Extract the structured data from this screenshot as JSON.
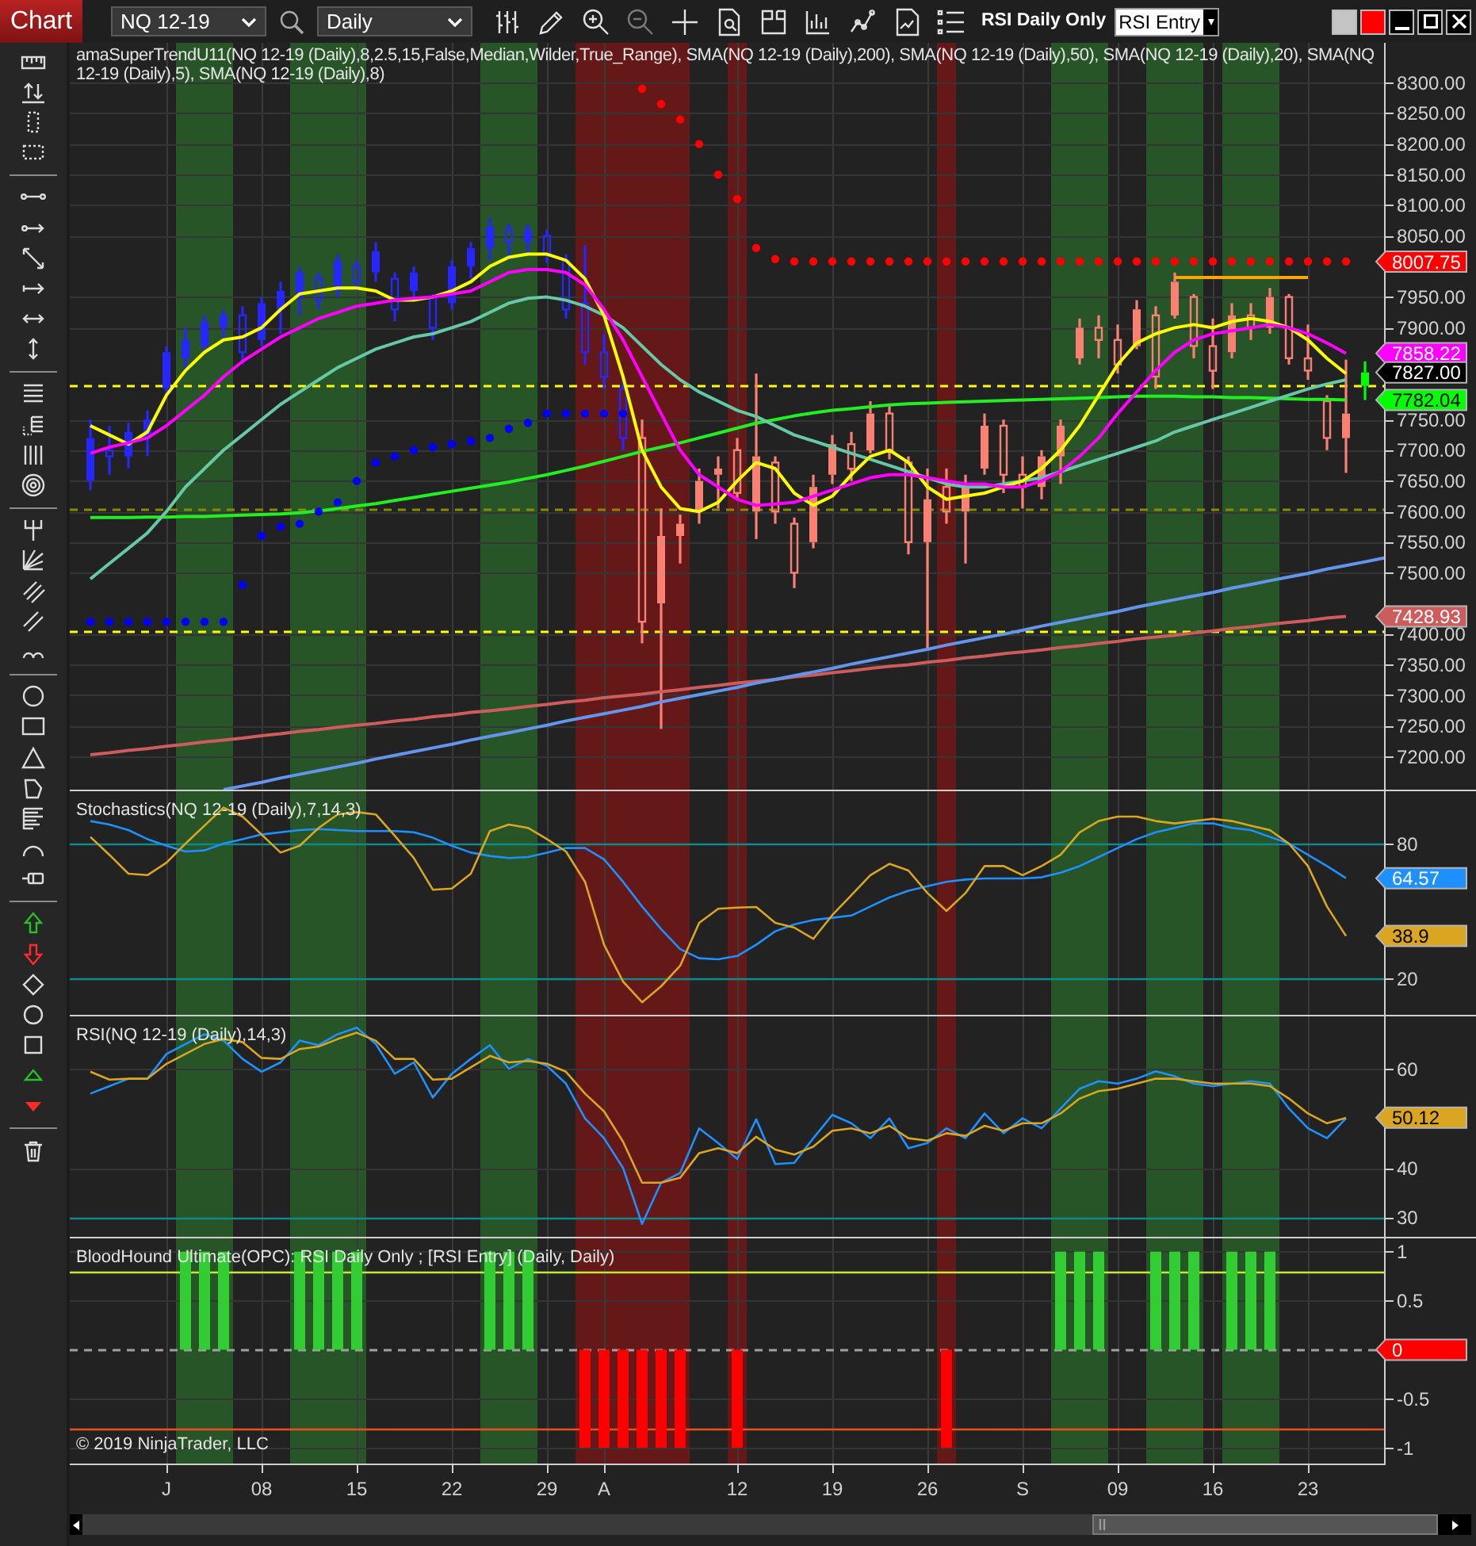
{
  "toolbar": {
    "tab": "Chart",
    "instrument": "NQ 12-19",
    "interval": "Daily",
    "zoom_out": {
      "disabled": true
    },
    "strategy_name": "RSI Daily Only",
    "strategy_entry": "RSI Entry"
  },
  "panels": [
    {
      "kind": "price",
      "chart_data": {
        "type": "candlestick",
        "title": "amaSuperTrendU11(NQ 12-19 (Daily),8,2.5,15,False,Median,Wilder,True_Range), SMA(NQ 12-19 (Daily),200), SMA(NQ 12-19 (Daily),50), SMA(NQ 12-19 (Daily),20), SMA(NQ 12-19 (Daily),5), SMA(NQ 12-19 (Daily),8)",
        "ylim": [
          7146,
          8365
        ],
        "grid": true,
        "yticks": [
          {
            "value": 7200,
            "label": "7200.00"
          },
          {
            "value": 7250,
            "label": "7250.00"
          },
          {
            "value": 7300,
            "label": "7300.00"
          },
          {
            "value": 7350,
            "label": "7350.00"
          },
          {
            "value": 7400,
            "label": "7400.00"
          },
          {
            "value": 7500,
            "label": "7500.00"
          },
          {
            "value": 7550,
            "label": "7550.00"
          },
          {
            "value": 7600,
            "label": "7600.00"
          },
          {
            "value": 7650,
            "label": "7650.00"
          },
          {
            "value": 7700,
            "label": "7700.00"
          },
          {
            "value": 7750,
            "label": "7750.00"
          },
          {
            "value": 7900,
            "label": "7900.00"
          },
          {
            "value": 7950,
            "label": "7950.00"
          },
          {
            "value": 8050,
            "label": "8050.00"
          },
          {
            "value": 8100,
            "label": "8100.00"
          },
          {
            "value": 8150,
            "label": "8150.00"
          },
          {
            "value": 8200,
            "label": "8200.00"
          },
          {
            "value": 8250,
            "label": "8250.00"
          },
          {
            "value": 8300,
            "label": "8300.00"
          }
        ],
        "series": [
          {
            "type": "line",
            "color": "#cd5c5c",
            "values": [
              7203,
              7206,
              7210,
              7213,
              7217,
              7220,
              7224,
              7227,
              7230,
              7234,
              7237,
              7241,
              7244,
              7248,
              7251,
              7254,
              7258,
              7261,
              7265,
              7268,
              7272,
              7275,
              7278,
              7282,
              7285,
              7289,
              7292,
              7296,
              7299,
              7302,
              7306,
              7309,
              7313,
              7316,
              7320,
              7323,
              7326,
              7330,
              7333,
              7337,
              7340,
              7344,
              7347,
              7350,
              7354,
              7357,
              7361,
              7364,
              7368,
              7371,
              7374,
              7378,
              7381,
              7385,
              7388,
              7392,
              7395,
              7398,
              7402,
              7405,
              7409,
              7412,
              7416,
              7419,
              7422,
              7426,
              7429
            ]
          },
          {
            "type": "line",
            "color": "#22ee22",
            "values": [
              7590,
              7590,
              7590,
              7591,
              7591,
              7592,
              7592,
              7593,
              7594,
              7595,
              7596,
              7598,
              7601,
              7605,
              7609,
              7613,
              7618,
              7623,
              7628,
              7633,
              7638,
              7643,
              7648,
              7654,
              7660,
              7667,
              7674,
              7682,
              7690,
              7698,
              7705,
              7712,
              7720,
              7728,
              7736,
              7744,
              7750,
              7756,
              7761,
              7765,
              7768,
              7771,
              7774,
              7776,
              7777,
              7778,
              7779,
              7780,
              7781,
              7782,
              7783,
              7784,
              7785,
              7786,
              7787,
              7788,
              7788,
              7788,
              7787,
              7787,
              7786,
              7786,
              7785,
              7784,
              7783,
              7783,
              7782
            ]
          },
          {
            "type": "line",
            "color": "#66c8a6",
            "values": [
              7490,
              7515,
              7540,
              7565,
              7600,
              7640,
              7670,
              7700,
              7725,
              7750,
              7775,
              7795,
              7815,
              7835,
              7850,
              7865,
              7875,
              7885,
              7890,
              7900,
              7910,
              7925,
              7940,
              7948,
              7950,
              7945,
              7935,
              7920,
              7900,
              7870,
              7840,
              7815,
              7795,
              7780,
              7765,
              7755,
              7740,
              7725,
              7715,
              7705,
              7695,
              7685,
              7675,
              7665,
              7655,
              7645,
              7640,
              7640,
              7645,
              7650,
              7655,
              7665,
              7675,
              7685,
              7695,
              7705,
              7715,
              7730,
              7740,
              7750,
              7760,
              7770,
              7780,
              7790,
              7800,
              7808,
              7815
            ]
          },
          {
            "type": "line",
            "color": "#ffff00",
            "values": [
              7740,
              7725,
              7710,
              7730,
              7790,
              7830,
              7860,
              7880,
              7885,
              7900,
              7930,
              7955,
              7960,
              7965,
              7965,
              7960,
              7945,
              7945,
              7950,
              7960,
              7975,
              8000,
              8015,
              8020,
              8020,
              8010,
              7980,
              7920,
              7820,
              7700,
              7640,
              7605,
              7600,
              7615,
              7650,
              7680,
              7670,
              7630,
              7610,
              7625,
              7660,
              7690,
              7700,
              7680,
              7640,
              7620,
              7625,
              7630,
              7640,
              7650,
              7670,
              7700,
              7740,
              7790,
              7840,
              7875,
              7890,
              7900,
              7905,
              7900,
              7910,
              7915,
              7910,
              7900,
              7880,
              7850,
              7825
            ]
          },
          {
            "type": "line",
            "color": "#ff00ff",
            "values": [
              7695,
              7705,
              7712,
              7720,
              7740,
              7765,
              7790,
              7820,
              7845,
              7865,
              7885,
              7900,
              7915,
              7925,
              7935,
              7940,
              7945,
              7948,
              7950,
              7955,
              7960,
              7975,
              7990,
              7995,
              7995,
              7990,
              7970,
              7930,
              7880,
              7820,
              7760,
              7700,
              7660,
              7640,
              7620,
              7610,
              7612,
              7615,
              7625,
              7635,
              7645,
              7655,
              7660,
              7660,
              7655,
              7650,
              7645,
              7645,
              7640,
              7640,
              7650,
              7665,
              7690,
              7720,
              7760,
              7795,
              7830,
              7860,
              7880,
              7890,
              7895,
              7900,
              7905,
              7900,
              7890,
              7875,
              7858
            ]
          },
          {
            "type": "scatter",
            "color": "#ff0000",
            "values": [
              null,
              null,
              null,
              null,
              null,
              null,
              null,
              null,
              null,
              null,
              null,
              null,
              null,
              null,
              null,
              null,
              null,
              null,
              null,
              null,
              null,
              null,
              null,
              null,
              null,
              null,
              null,
              null,
              null,
              8290,
              8265,
              8240,
              8200,
              8150,
              8110,
              8030,
              8012,
              8008,
              8008,
              8008,
              8008,
              8008,
              8008,
              8008,
              8008,
              8008,
              8008,
              8008,
              8008,
              8008,
              8008,
              8008,
              8008,
              8008,
              8008,
              8008,
              8008,
              8008,
              8008,
              8008,
              8008,
              8008,
              8008,
              8008,
              8008,
              8008,
              8008
            ]
          },
          {
            "type": "scatter",
            "color": "#0000ff",
            "values": [
              7420,
              7420,
              7420,
              7420,
              7420,
              7420,
              7420,
              7420,
              7480,
              7560,
              7575,
              7580,
              7600,
              7615,
              7650,
              7680,
              7690,
              7700,
              7705,
              7710,
              7715,
              7720,
              7735,
              7745,
              7760,
              7760,
              7760,
              7760,
              7760
            ]
          },
          {
            "type": "candlestick",
            "color": "#2626ff",
            "ohlc": [
              [
                7650,
                7750,
                7635,
                7720
              ],
              [
                7700,
                7740,
                7660,
                7690
              ],
              [
                7690,
                7745,
                7670,
                7730
              ],
              [
                7720,
                7765,
                7690,
                7750
              ],
              [
                7800,
                7870,
                7790,
                7860
              ],
              [
                7850,
                7900,
                7830,
                7880
              ],
              [
                7870,
                7920,
                7860,
                7910
              ],
              [
                7900,
                7930,
                7880,
                7920
              ],
              [
                7920,
                7935,
                7840,
                7860
              ],
              [
                7880,
                7950,
                7870,
                7940
              ],
              [
                7930,
                7975,
                7890,
                7960
              ],
              [
                7950,
                8000,
                7920,
                7990
              ],
              [
                7980,
                7990,
                7930,
                7945
              ],
              [
                7960,
                8020,
                7950,
                8010
              ],
              [
                8000,
                8010,
                7960,
                7975
              ],
              [
                7990,
                8040,
                7975,
                8025
              ],
              [
                7980,
                7990,
                7910,
                7930
              ],
              [
                7960,
                8000,
                7950,
                7990
              ],
              [
                7950,
                7955,
                7880,
                7900
              ],
              [
                7940,
                8010,
                7930,
                8000
              ],
              [
                8000,
                8040,
                7980,
                8030
              ],
              [
                8030,
                8080,
                8010,
                8065
              ],
              [
                8060,
                8070,
                8010,
                8040
              ],
              [
                8040,
                8070,
                8020,
                8060
              ],
              [
                8050,
                8060,
                8005,
                8020
              ],
              [
                8010,
                8020,
                7915,
                7930
              ],
              [
                7940,
                8035,
                7840,
                7860
              ],
              [
                7860,
                7890,
                7800,
                7820
              ],
              [
                7800,
                7815,
                7700,
                7720
              ]
            ]
          },
          {
            "type": "candlestick",
            "color": "#fa8072",
            "ohlc": [
              null,
              null,
              null,
              null,
              null,
              null,
              null,
              null,
              null,
              null,
              null,
              null,
              null,
              null,
              null,
              null,
              null,
              null,
              null,
              null,
              null,
              null,
              null,
              null,
              null,
              null,
              null,
              null,
              null,
              [
                7720,
                7750,
                7385,
                7420
              ],
              [
                7450,
                7605,
                7245,
                7560
              ],
              [
                7560,
                7595,
                7515,
                7580
              ],
              [
                7600,
                7670,
                7580,
                7650
              ],
              [
                7660,
                7690,
                7605,
                7670
              ],
              [
                7700,
                7720,
                7620,
                7630
              ],
              [
                7600,
                7825,
                7555,
                7690
              ],
              [
                7680,
                7690,
                7580,
                7600
              ],
              [
                7580,
                7590,
                7475,
                7500
              ],
              [
                7550,
                7660,
                7540,
                7640
              ],
              [
                7660,
                7725,
                7645,
                7710
              ],
              [
                7710,
                7730,
                7650,
                7670
              ],
              [
                7700,
                7780,
                7695,
                7760
              ],
              [
                7760,
                7775,
                7685,
                7700
              ],
              [
                7680,
                7690,
                7530,
                7550
              ],
              [
                7550,
                7670,
                7375,
                7620
              ],
              [
                7640,
                7670,
                7580,
                7600
              ],
              [
                7600,
                7660,
                7515,
                7640
              ],
              [
                7670,
                7760,
                7660,
                7740
              ],
              [
                7740,
                7750,
                7630,
                7660
              ],
              [
                7660,
                7690,
                7605,
                7640
              ],
              [
                7640,
                7700,
                7620,
                7690
              ],
              [
                7690,
                7750,
                7645,
                7740
              ],
              [
                7850,
                7915,
                7840,
                7900
              ],
              [
                7900,
                7920,
                7850,
                7880
              ],
              [
                7880,
                7905,
                7825,
                7840
              ],
              [
                7870,
                7945,
                7865,
                7930
              ],
              [
                7920,
                7935,
                7800,
                7820
              ],
              [
                7920,
                7990,
                7915,
                7975
              ],
              [
                7950,
                7955,
                7850,
                7870
              ],
              [
                7870,
                7915,
                7800,
                7830
              ],
              [
                7860,
                7940,
                7850,
                7920
              ],
              [
                7920,
                7940,
                7880,
                7900
              ],
              [
                7900,
                7965,
                7890,
                7950
              ],
              [
                7950,
                7955,
                7840,
                7850
              ],
              [
                7850,
                7905,
                7815,
                7830
              ],
              [
                7780,
                7790,
                7700,
                7720
              ],
              [
                7720,
                7848,
                7663,
                7760
              ]
            ]
          },
          {
            "type": "candlestick",
            "color": "#00ff00",
            "ohlc": [
              null,
              null,
              null,
              null,
              null,
              null,
              null,
              null,
              null,
              null,
              null,
              null,
              null,
              null,
              null,
              null,
              null,
              null,
              null,
              null,
              null,
              null,
              null,
              null,
              null,
              null,
              null,
              null,
              null,
              null,
              null,
              null,
              null,
              null,
              null,
              null,
              null,
              null,
              null,
              null,
              null,
              null,
              null,
              null,
              null,
              null,
              null,
              null,
              null,
              null,
              null,
              null,
              null,
              null,
              null,
              null,
              null,
              null,
              null,
              null,
              null,
              null,
              null,
              null,
              null,
              null,
              null,
              [
                7805,
                7845,
                7782,
                7827
              ]
            ]
          },
          {
            "type": "line",
            "color": "#6495ed",
            "values": [
              null,
              null,
              null,
              null,
              null,
              null,
              null,
              7146,
              7152,
              7158,
              7165,
              7171,
              7177,
              7183,
              7189,
              7196,
              7202,
              7208,
              7214,
              7220,
              7227,
              7233,
              7239,
              7245,
              7251,
              7258,
              7264,
              7270,
              7276,
              7282,
              7289,
              7295,
              7301,
              7307,
              7313,
              7320,
              7326,
              7332,
              7338,
              7344,
              7351,
              7357,
              7363,
              7369,
              7375,
              7382,
              7388,
              7394,
              7400,
              7406,
              7413,
              7419,
              7425,
              7431,
              7437,
              7444,
              7450,
              7456,
              7462,
              7468,
              7475,
              7481,
              7487,
              7493,
              7499,
              7506,
              7512,
              7518,
              7524
            ]
          },
          {
            "type": "line",
            "color": "#ffa500",
            "values": [
              null,
              null,
              null,
              null,
              null,
              null,
              null,
              null,
              null,
              null,
              null,
              null,
              null,
              null,
              null,
              null,
              null,
              null,
              null,
              null,
              null,
              null,
              null,
              null,
              null,
              null,
              null,
              null,
              null,
              null,
              null,
              null,
              null,
              null,
              null,
              null,
              null,
              null,
              null,
              null,
              null,
              null,
              null,
              null,
              null,
              null,
              null,
              null,
              null,
              null,
              null,
              null,
              null,
              null,
              null,
              null,
              null,
              7982,
              7982,
              7982,
              7982,
              7982,
              7982,
              7982,
              7982
            ]
          }
        ],
        "ref_lines": [
          {
            "axis": "y",
            "value": 7807,
            "color": "#ffff00"
          },
          {
            "axis": "y",
            "value": 7604,
            "color": "#8a8a00"
          },
          {
            "axis": "y",
            "value": 7405,
            "color": "#ffff00"
          }
        ],
        "value_labels": [
          {
            "text": "8007.75",
            "color": "#ff0000"
          },
          {
            "text": "7858.22",
            "color": "#ff00ff"
          },
          {
            "text": "7827.00",
            "color": "#000000"
          },
          {
            "text": "7782.04",
            "color": "#00ff00"
          },
          {
            "text": "7428.93",
            "color": "#cd5c5c"
          }
        ]
      }
    },
    {
      "kind": "oscillator",
      "chart_data": {
        "type": "line",
        "title": "Stochastics(NQ 12-19 (Daily),7,14,3)",
        "ylim": [
          3.8,
          104
        ],
        "grid": true,
        "yticks": [
          {
            "value": 20,
            "label": "20"
          },
          {
            "value": 80,
            "label": "80"
          }
        ],
        "series": [
          {
            "color": "#1e90ff",
            "values": [
              90,
              88.5,
              86,
              82,
              79,
              76.5,
              77,
              80,
              82,
              84,
              85,
              86,
              86.4,
              86,
              85.6,
              85.6,
              85.6,
              85,
              82.6,
              79,
              76,
              74.5,
              73.6,
              74,
              76,
              78,
              78,
              73,
              63,
              52,
              42,
              33,
              29,
              28.5,
              30,
              35,
              41,
              44,
              46,
              47,
              48,
              52,
              56,
              59,
              61,
              63,
              64,
              64.5,
              64.5,
              64.5,
              65,
              67,
              70,
              74,
              78,
              82,
              85,
              87,
              89,
              89,
              87,
              86,
              83,
              80,
              75,
              70,
              64.6
            ]
          },
          {
            "color": "#daa520",
            "values": [
              83,
              75,
              66.6,
              66,
              71.5,
              80,
              88,
              96,
              92,
              84,
              76,
              79,
              87,
              93,
              94,
              93,
              83.5,
              73.6,
              59.5,
              60,
              66.6,
              85.6,
              88.5,
              87,
              82,
              76.5,
              63,
              35,
              18.6,
              9.4,
              16.5,
              25.6,
              44.7,
              51,
              51.5,
              51.8,
              44.7,
              42.6,
              37.6,
              48.2,
              57,
              66,
              71,
              68,
              58,
              50,
              58,
              70,
              70,
              66,
              70,
              75,
              85,
              90,
              92,
              92,
              90,
              89,
              90,
              91,
              90,
              88,
              86,
              80,
              70,
              52,
              38.9
            ]
          }
        ],
        "ref_lines": [
          {
            "axis": "y",
            "value": 80,
            "color": "#0e8a8a"
          },
          {
            "axis": "y",
            "value": 20,
            "color": "#0e8a8a"
          }
        ],
        "value_labels": [
          {
            "text": "64.57",
            "color": "#1e90ff"
          },
          {
            "text": "38.9",
            "color": "#daa520"
          }
        ]
      }
    },
    {
      "kind": "oscillator",
      "chart_data": {
        "type": "line",
        "title": "RSI(NQ 12-19 (Daily),14,3)",
        "ylim": [
          26.1,
          70.9
        ],
        "grid": true,
        "yticks": [
          {
            "value": 30,
            "label": "30"
          },
          {
            "value": 40,
            "label": "40"
          },
          {
            "value": 60,
            "label": "60"
          }
        ],
        "series": [
          {
            "color": "#1e90ff",
            "values": [
              55,
              56.5,
              58,
              58,
              63,
              65,
              67,
              65.7,
              62,
              59.4,
              61.3,
              65.7,
              64.8,
              67,
              68.3,
              65,
              59,
              61.3,
              54.2,
              59,
              62,
              64.8,
              60,
              62,
              60.6,
              57,
              50,
              46,
              40,
              28.7,
              37,
              39,
              48,
              45,
              41.8,
              49.8,
              40.8,
              41,
              46,
              50.7,
              49,
              46,
              50,
              44,
              45,
              48,
              46,
              51,
              47,
              50,
              48,
              52,
              56,
              57.5,
              57,
              58,
              59.5,
              58.5,
              57,
              56.5,
              57,
              57.5,
              57,
              52,
              48,
              46,
              50
            ]
          },
          {
            "color": "#daa520",
            "values": [
              59.4,
              57.8,
              58,
              58,
              61,
              63,
              65,
              66,
              65.4,
              62.2,
              62,
              64,
              64.5,
              66,
              67.3,
              65.7,
              62,
              62,
              57.8,
              58,
              60.3,
              62.6,
              61.3,
              61.6,
              61,
              59.4,
              55,
              51.4,
              45.3,
              37,
              37,
              38,
              43,
              44,
              43,
              46.3,
              43.7,
              42.7,
              44.3,
              47.5,
              48,
              47,
              48.5,
              46,
              45.5,
              47,
              46.5,
              48.5,
              47.5,
              49,
              49,
              51,
              54,
              55.5,
              56,
              57,
              58,
              58,
              57.5,
              57,
              57,
              57,
              56.5,
              54,
              51,
              49,
              50.1
            ]
          }
        ],
        "ref_lines": [
          {
            "axis": "y",
            "value": 30,
            "color": "#0e8a8a"
          }
        ],
        "value_labels": [
          {
            "text": "50.12",
            "color": "#daa520"
          }
        ]
      }
    },
    {
      "kind": "signal",
      "copyright": "© 2019 NinjaTrader, LLC",
      "chart_data": {
        "type": "bar",
        "title": "BloodHound Ultimate(OPC): RSI Daily Only ; [RSI Entry] (Daily, Daily)",
        "categories": [
          null,
          null,
          null,
          null,
          "J",
          null,
          null,
          null,
          null,
          "08",
          null,
          null,
          null,
          null,
          "15",
          null,
          null,
          null,
          null,
          "22",
          null,
          null,
          null,
          null,
          "29",
          null,
          null,
          "A",
          null,
          null,
          null,
          null,
          null,
          null,
          "12",
          null,
          null,
          null,
          null,
          "19",
          null,
          null,
          null,
          null,
          "26",
          null,
          null,
          null,
          null,
          "S",
          null,
          null,
          null,
          null,
          "09",
          null,
          null,
          null,
          null,
          "16",
          null,
          null,
          null,
          null,
          "23",
          null,
          null,
          null
        ],
        "ylim": [
          -1.16,
          1.15
        ],
        "grid": true,
        "yticks": [
          -1,
          -0.5,
          0.5,
          1
        ],
        "series": [
          {
            "color": "#32cd32",
            "values": [
              0,
              0,
              0,
              0,
              0,
              1,
              1,
              1,
              0,
              0,
              0,
              1,
              1,
              1,
              1,
              0,
              0,
              0,
              0,
              0,
              0,
              1,
              1,
              1,
              0,
              0,
              0,
              0,
              0,
              0,
              0,
              0,
              0,
              0,
              0,
              0,
              0,
              0,
              0,
              0,
              0,
              0,
              0,
              0,
              0,
              0,
              0,
              0,
              0,
              0,
              0,
              1,
              1,
              1,
              0,
              0,
              1,
              1,
              1,
              0,
              1,
              1,
              1,
              0,
              0,
              0,
              0,
              0
            ]
          },
          {
            "color": "#ff0000",
            "values": [
              0,
              0,
              0,
              0,
              0,
              0,
              0,
              0,
              0,
              0,
              0,
              0,
              0,
              0,
              0,
              0,
              0,
              0,
              0,
              0,
              0,
              0,
              0,
              0,
              0,
              0,
              -1,
              -1,
              -1,
              -1,
              -1,
              -1,
              0,
              0,
              -1,
              0,
              0,
              0,
              0,
              0,
              0,
              0,
              0,
              0,
              0,
              -1,
              0,
              0,
              0,
              0,
              0,
              0,
              0,
              0,
              0,
              0,
              0,
              0,
              0,
              0,
              0,
              0,
              0,
              0,
              0,
              0,
              0,
              0
            ]
          }
        ],
        "ref_lines": [
          {
            "axis": "y",
            "value": 0.8,
            "color": "#c4e83a"
          },
          {
            "axis": "y",
            "value": -0.8,
            "color": "#e8501e"
          },
          {
            "axis": "y",
            "value": 0,
            "color": "#a0a0a0"
          }
        ],
        "value_labels": [
          {
            "text": "0",
            "color": "#ff0000"
          }
        ]
      }
    }
  ]
}
